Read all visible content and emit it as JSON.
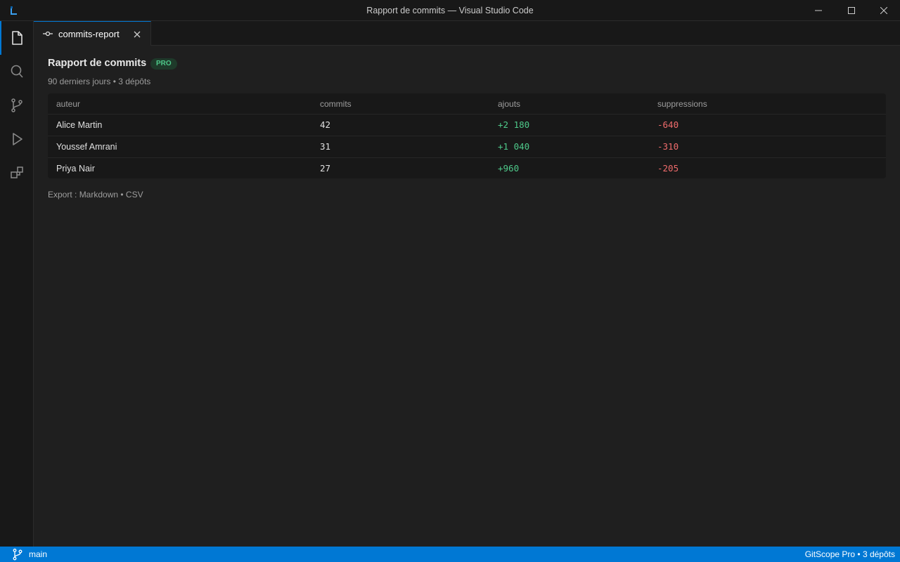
{
  "window": {
    "title": "Rapport de commits — Visual Studio Code"
  },
  "activity_bar": {
    "items": [
      {
        "name": "explorer",
        "icon": "files-icon",
        "active": true
      },
      {
        "name": "search",
        "icon": "search-icon",
        "active": false
      },
      {
        "name": "source-control",
        "icon": "source-control-icon",
        "active": false
      },
      {
        "name": "run",
        "icon": "run-icon",
        "active": false
      },
      {
        "name": "extensions",
        "icon": "extensions-icon",
        "active": false
      }
    ]
  },
  "tab": {
    "label": "commits-report",
    "icon": "git-commit-icon"
  },
  "report": {
    "title": "Rapport de commits",
    "badge": "PRO",
    "subtitle": "90 derniers jours • 3 dépôts",
    "columns": [
      "auteur",
      "commits",
      "ajouts",
      "suppressions"
    ],
    "rows": [
      {
        "author": "Alice Martin",
        "commits": "42",
        "additions": "+2 180",
        "deletions": "-640"
      },
      {
        "author": "Youssef Amrani",
        "commits": "31",
        "additions": "+1 040",
        "deletions": "-310"
      },
      {
        "author": "Priya Nair",
        "commits": "27",
        "additions": "+960",
        "deletions": "-205"
      }
    ],
    "export": {
      "prefix": "Export : ",
      "markdown": "Markdown",
      "separator": " • ",
      "csv": "CSV"
    }
  },
  "status_bar": {
    "branch": "main",
    "right_text": "GitScope Pro • 3 dépôts"
  },
  "colors": {
    "accent": "#0078d4",
    "additions": "#4ec98a",
    "deletions": "#f06c6c"
  }
}
